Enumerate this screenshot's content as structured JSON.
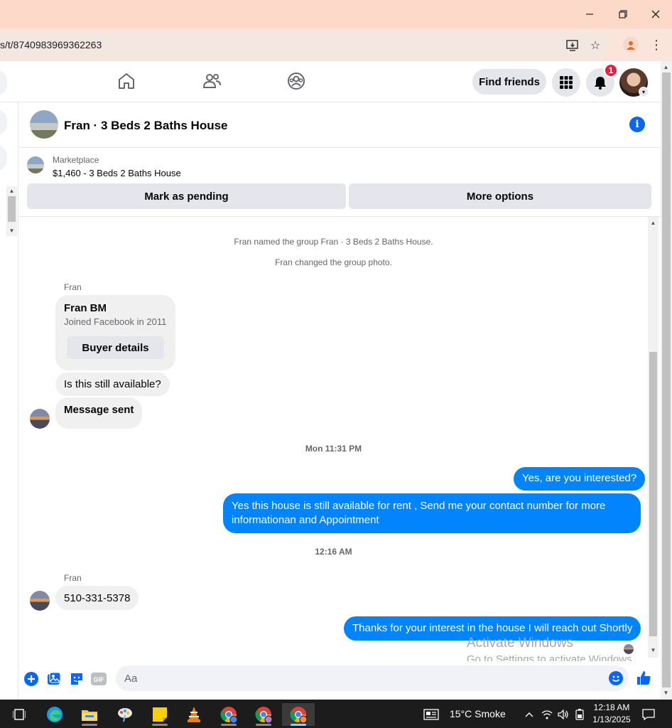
{
  "browser": {
    "url": "s/t/8740983969362263",
    "colors": {
      "titlebar": "#fcd9c8",
      "toolbar": "#fbe5da"
    }
  },
  "fb_nav": {
    "find_friends_label": "Find friends",
    "notification_count": "1"
  },
  "chat": {
    "title": "Fran · 3 Beds 2 Baths House",
    "marketplace": {
      "label": "Marketplace",
      "listing": "$1,460 - 3 Beds 2 Baths House",
      "mark_pending_label": "Mark as pending",
      "more_options_label": "More options"
    },
    "system_messages": [
      "Fran named the group Fran · 3 Beds 2 Baths House.",
      "Fran changed the group photo."
    ],
    "sender_name": "Fran",
    "profile_card": {
      "name": "Fran BM",
      "subtitle": "Joined Facebook in 2011",
      "button_label": "Buyer details"
    },
    "incoming_1": "Is this still available?",
    "incoming_2": "Message sent",
    "timestamp_1": "Mon 11:31 PM",
    "outgoing_1": "Yes, are you interested?",
    "outgoing_2": "Yes this house is still available for rent , Send me your contact number for more informationan and Appointment",
    "timestamp_2": "12:16 AM",
    "incoming_3": "510-331-5378",
    "outgoing_3": "Thanks for your interest in the house I will reach out Shortly",
    "composer_placeholder": "Aa",
    "gif_label": "GIF",
    "colors": {
      "outgoing_bubble": "#0084ff",
      "incoming_bubble": "#f0f0f0",
      "accent": "#0866ff"
    }
  },
  "watermark": {
    "line1": "Activate Windows",
    "line2": "Go to Settings to activate Windows."
  },
  "taskbar": {
    "weather": "15°C  Smoke",
    "time": "12:18 AM",
    "date": "1/13/2025"
  }
}
